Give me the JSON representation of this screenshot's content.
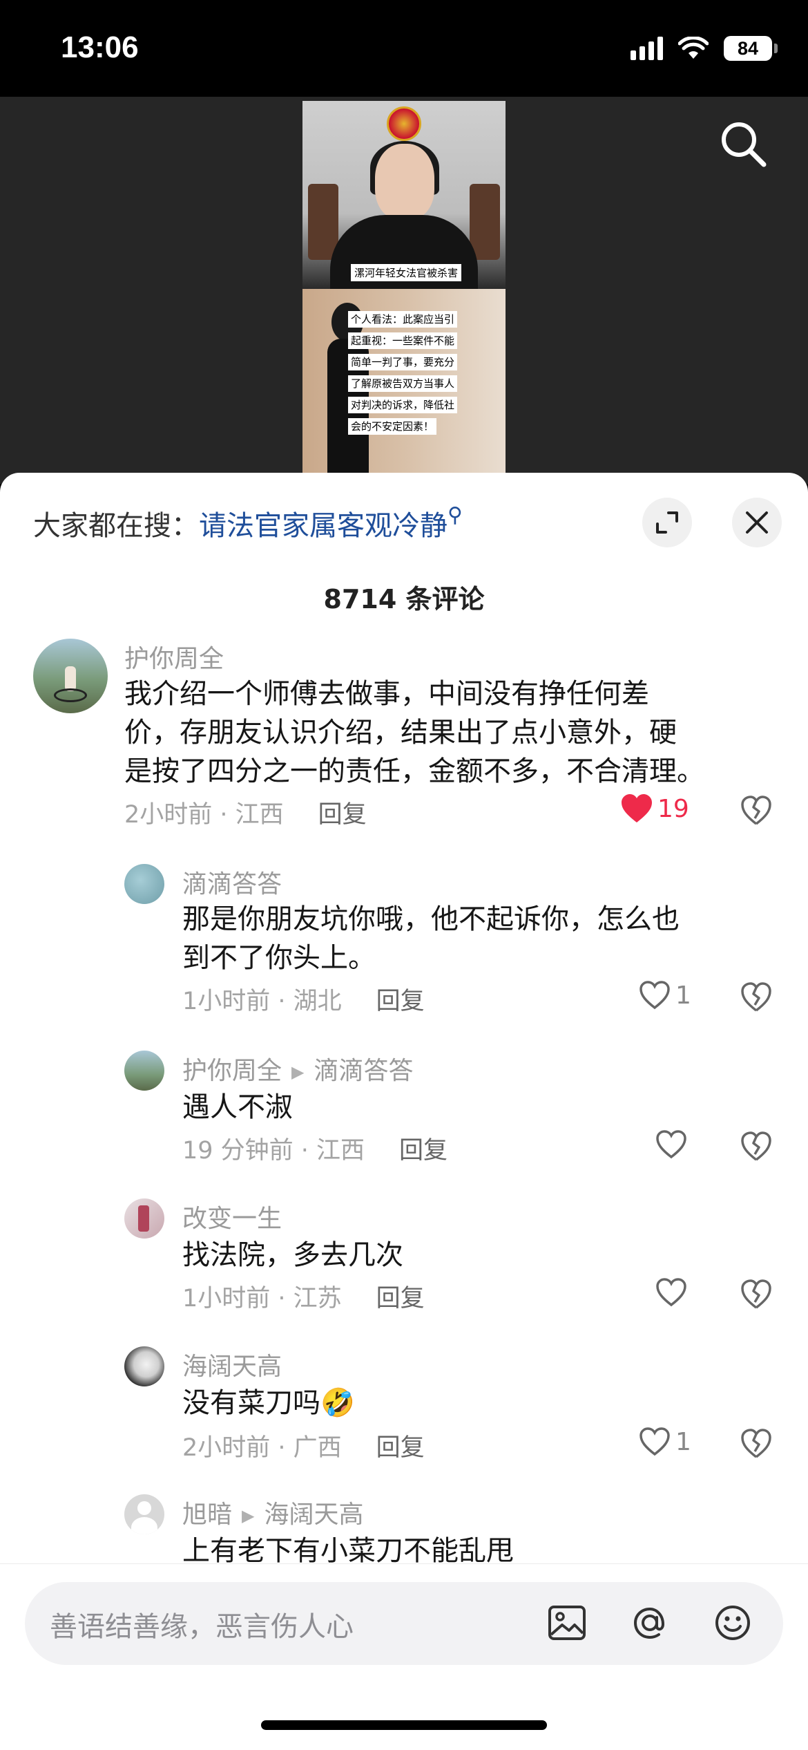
{
  "status_bar": {
    "time": "13:06",
    "battery": "84"
  },
  "video": {
    "caption_top": "漯河年轻女法官被杀害",
    "caption_lines": [
      "个人看法：此案应当引",
      "起重视：一些案件不能",
      "简单一判了事，要充分",
      "了解原被告双方当事人",
      "对判决的诉求，降低社",
      "会的不安定因素！"
    ]
  },
  "panel": {
    "hot_search_prefix": "大家都在搜：",
    "hot_search_keyword": "请法官家属客观冷静",
    "comment_count": "8714 条评论"
  },
  "comments": [
    {
      "user": "护你周全",
      "lines": [
        "我介绍一个师傅去做事，中间没有挣任何差",
        "价，存朋友认识介绍，结果出了点小意外，硬",
        "是按了四分之一的责任，金额不多，不合清理。"
      ],
      "time_location": "2小时前 · 江西",
      "reply": "回复",
      "likes": "19"
    },
    {
      "user": "滴滴答答",
      "lines": [
        "那是你朋友坑你哦，他不起诉你，怎么也",
        "到不了你头上。"
      ],
      "time_location": "1小时前 · 湖北",
      "reply": "回复",
      "likes": "1"
    },
    {
      "user": "护你周全",
      "reply_to": "滴滴答答",
      "lines": [
        "遇人不淑"
      ],
      "time_location": "19 分钟前 · 江西",
      "reply": "回复",
      "likes": ""
    },
    {
      "user": "改变一生",
      "lines": [
        "找法院，多去几次"
      ],
      "time_location": "1小时前 · 江苏",
      "reply": "回复",
      "likes": ""
    },
    {
      "user": "海阔天高",
      "lines": [
        "没有菜刀吗🤣"
      ],
      "time_location": "2小时前 · 广西",
      "reply": "回复",
      "likes": "1"
    },
    {
      "user": "旭暗",
      "reply_to": "海阔天高",
      "lines": [
        "上有老下有小菜刀不能乱甩"
      ]
    }
  ],
  "input": {
    "placeholder": "善语结善缘，恶言伤人心"
  },
  "colors": {
    "accent_like": "#ee2a4a",
    "keyword": "#1f4e9a"
  },
  "icons": [
    "search-icon",
    "expand-icon",
    "close-icon",
    "heart-icon",
    "dislike-icon",
    "image-icon",
    "at-icon",
    "emoji-icon"
  ]
}
